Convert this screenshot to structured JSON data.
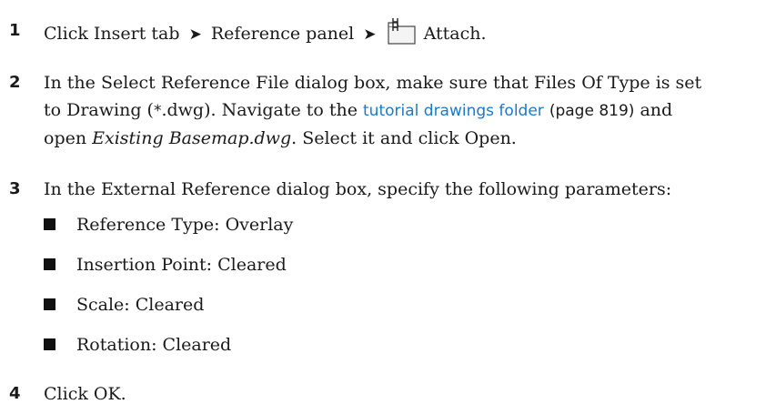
{
  "steps": [
    {
      "number": "1",
      "pre": "Click Insert tab",
      "arrow": "➤",
      "middle": "Reference panel",
      "arrow2": "➤",
      "icon": "attach-icon",
      "post": "Attach."
    },
    {
      "number": "2",
      "line1": "In the Select Reference File dialog box, make sure that Files Of Type is set",
      "line2_pre": "to Drawing (",
      "line2_code": "*",
      "line2_mid": ".dwg). Navigate to the ",
      "link_text": "tutorial drawings folder",
      "page_ref": "(page 819)",
      "line2_post": " and",
      "line3_pre": "open ",
      "line3_file": "Existing Basemap.dwg",
      "line3_post": ". Select it and click Open."
    },
    {
      "number": "3",
      "text": "In the External Reference dialog box, specify the following parameters:",
      "params": [
        "Reference Type: Overlay",
        "Insertion Point: Cleared",
        "Scale: Cleared",
        "Rotation: Cleared"
      ]
    },
    {
      "number": "4",
      "text": "Click OK."
    }
  ]
}
